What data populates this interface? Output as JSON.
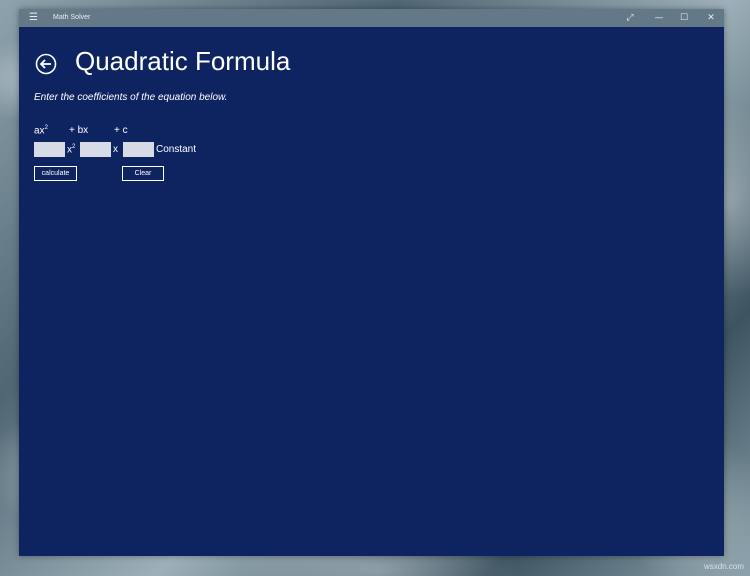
{
  "window": {
    "app_title": "Math Solver",
    "controls": {
      "menu_icon": "hamburger-icon",
      "expand_icon": "expand-icon",
      "minimize_icon": "minimize-icon",
      "maximize_icon": "maximize-icon",
      "close_icon": "close-icon"
    }
  },
  "page": {
    "back_icon": "back-arrow-icon",
    "title": "Quadratic Formula",
    "instructions": "Enter the coefficients of the equation below."
  },
  "equation": {
    "terms": {
      "a_prefix": "ax",
      "a_sup": "2",
      "b": "+ bx",
      "c": "+ c"
    },
    "inputs": {
      "a_value": "",
      "b_value": "",
      "c_value": ""
    },
    "labels": {
      "x": "x",
      "x_sup": "2",
      "x_single": "x",
      "constant": "Constant"
    }
  },
  "buttons": {
    "calculate": "calculate",
    "clear": "Clear"
  },
  "watermark": "wsxdn.com",
  "colors": {
    "window_background": "#0e2461",
    "titlebar": "#647987",
    "text": "#ffffff",
    "input_background": "#d6dbe5"
  }
}
